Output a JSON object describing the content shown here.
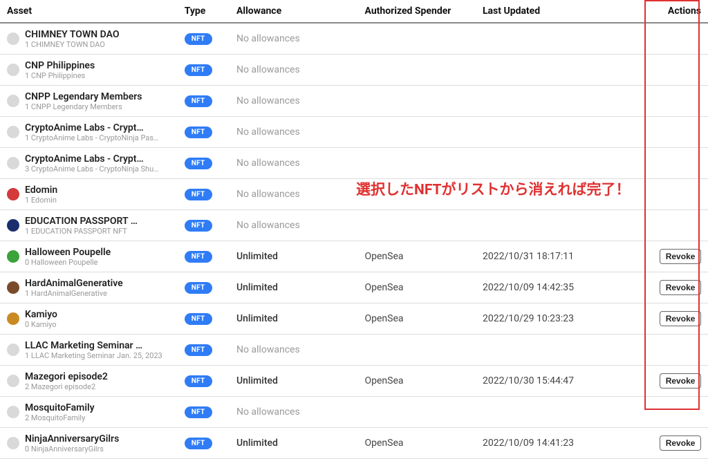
{
  "headers": {
    "asset": "Asset",
    "type": "Type",
    "allowance": "Allowance",
    "spender": "Authorized Spender",
    "updated": "Last Updated",
    "actions": "Actions"
  },
  "badge_label": "NFT",
  "revoke_label": "Revoke",
  "callout_text": "選択したNFTがリストから消えれば完了！",
  "allowance_none": "No allowances",
  "allowance_unlimited": "Unlimited",
  "rows": [
    {
      "name": "CHIMNEY TOWN DAO",
      "sub": "1 CHIMNEY TOWN DAO",
      "icon_color": "#d9d9d9",
      "allowance": "none",
      "spender": "",
      "updated": "",
      "revoke": false
    },
    {
      "name": "CNP Philippines",
      "sub": "1 CNP Philippines",
      "icon_color": "#d9d9d9",
      "allowance": "none",
      "spender": "",
      "updated": "",
      "revoke": false
    },
    {
      "name": "CNPP Legendary Members",
      "sub": "1 CNPP Legendary Members",
      "icon_color": "#d9d9d9",
      "allowance": "none",
      "spender": "",
      "updated": "",
      "revoke": false
    },
    {
      "name": "CryptoAnime Labs - Crypt…",
      "sub": "1 CryptoAnime Labs - CryptoNinja Pas…",
      "icon_color": "#d9d9d9",
      "allowance": "none",
      "spender": "",
      "updated": "",
      "revoke": false
    },
    {
      "name": "CryptoAnime Labs - Crypt…",
      "sub": "3 CryptoAnime Labs - CryptoNinja Shu…",
      "icon_color": "#d9d9d9",
      "allowance": "none",
      "spender": "",
      "updated": "",
      "revoke": false
    },
    {
      "name": "Edomin",
      "sub": "1 Edomin",
      "icon_color": "#d33a3a",
      "allowance": "none",
      "spender": "",
      "updated": "",
      "revoke": false
    },
    {
      "name": "EDUCATION PASSPORT …",
      "sub": "1 EDUCATION PASSPORT NFT",
      "icon_color": "#1a2e6e",
      "allowance": "none",
      "spender": "",
      "updated": "",
      "revoke": false
    },
    {
      "name": "Halloween Poupelle",
      "sub": "0 Halloween Poupelle",
      "icon_color": "#3aa33a",
      "allowance": "unlimited",
      "spender": "OpenSea",
      "updated": "2022/10/31 18:17:11",
      "revoke": true
    },
    {
      "name": "HardAnimalGenerative",
      "sub": "1 HardAnimalGenerative",
      "icon_color": "#7a4b2a",
      "allowance": "unlimited",
      "spender": "OpenSea",
      "updated": "2022/10/09 14:42:35",
      "revoke": true
    },
    {
      "name": "Kamiyo",
      "sub": "0 Kamiyo",
      "icon_color": "#c98b21",
      "allowance": "unlimited",
      "spender": "OpenSea",
      "updated": "2022/10/29 10:23:23",
      "revoke": true
    },
    {
      "name": "LLAC Marketing Seminar …",
      "sub": "1 LLAC Marketing Seminar Jan. 25, 2023",
      "icon_color": "#d9d9d9",
      "allowance": "none",
      "spender": "",
      "updated": "",
      "revoke": false
    },
    {
      "name": "Mazegori episode2",
      "sub": "2 Mazegori episode2",
      "icon_color": "#d9d9d9",
      "allowance": "unlimited",
      "spender": "OpenSea",
      "updated": "2022/10/30 15:44:47",
      "revoke": true
    },
    {
      "name": "MosquitoFamily",
      "sub": "2 MosquitoFamily",
      "icon_color": "#d9d9d9",
      "allowance": "none",
      "spender": "",
      "updated": "",
      "revoke": false
    },
    {
      "name": "NinjaAnniversaryGilrs",
      "sub": "0 NinjaAnniversaryGilrs",
      "icon_color": "#d9d9d9",
      "allowance": "unlimited",
      "spender": "OpenSea",
      "updated": "2022/10/09 14:41:23",
      "revoke": true
    }
  ]
}
